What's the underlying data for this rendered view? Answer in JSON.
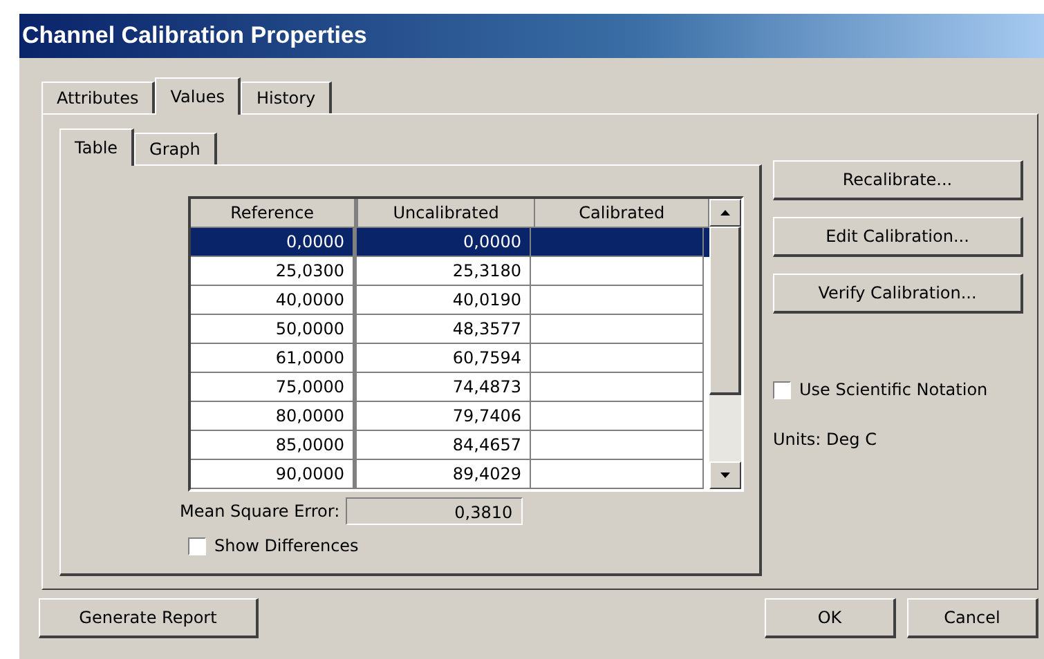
{
  "window": {
    "title": "Channel Calibration Properties"
  },
  "tabs": [
    {
      "label": "Attributes",
      "selected": false
    },
    {
      "label": "Values",
      "selected": true
    },
    {
      "label": "History",
      "selected": false
    }
  ],
  "subtabs": [
    {
      "label": "Table",
      "selected": true
    },
    {
      "label": "Graph",
      "selected": false
    }
  ],
  "table": {
    "columns": [
      "Reference",
      "Uncalibrated",
      "Calibrated"
    ],
    "rows": [
      {
        "cells": [
          "0,0000",
          "0,0000",
          ""
        ],
        "selected": true
      },
      {
        "cells": [
          "25,0300",
          "25,3180",
          ""
        ],
        "selected": false
      },
      {
        "cells": [
          "40,0000",
          "40,0190",
          ""
        ],
        "selected": false
      },
      {
        "cells": [
          "50,0000",
          "48,3577",
          ""
        ],
        "selected": false
      },
      {
        "cells": [
          "61,0000",
          "60,7594",
          ""
        ],
        "selected": false
      },
      {
        "cells": [
          "75,0000",
          "74,4873",
          ""
        ],
        "selected": false
      },
      {
        "cells": [
          "80,0000",
          "79,7406",
          ""
        ],
        "selected": false
      },
      {
        "cells": [
          "85,0000",
          "84,4657",
          ""
        ],
        "selected": false
      },
      {
        "cells": [
          "90,0000",
          "89,4029",
          ""
        ],
        "selected": false
      }
    ]
  },
  "mean_square_error": {
    "label": "Mean Square Error:",
    "value": "0,3810"
  },
  "show_differences": {
    "label": "Show Differences",
    "checked": false
  },
  "side_buttons": [
    "Recalibrate...",
    "Edit Calibration...",
    "Verify Calibration..."
  ],
  "scientific_notation": {
    "label": "Use Scientific Notation",
    "checked": false
  },
  "units": "Units: Deg C",
  "buttons": {
    "left": [
      "Generate Report"
    ],
    "right": [
      "OK",
      "Cancel"
    ]
  }
}
